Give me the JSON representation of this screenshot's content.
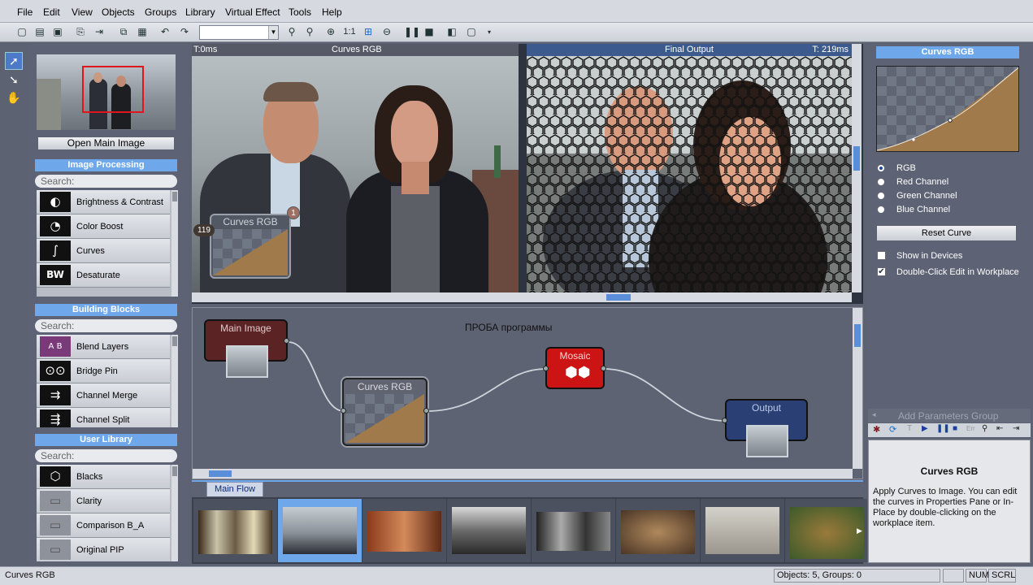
{
  "menu": [
    "File",
    "Edit",
    "View",
    "Objects",
    "Groups",
    "Library",
    "Virtual Effect",
    "Tools",
    "Help"
  ],
  "toolbar": {
    "zoom_value": "",
    "zoom_ratio": "1:1"
  },
  "left": {
    "open_button": "Open Main Image",
    "sections": [
      {
        "title": "Image Processing",
        "search_placeholder": "Search:",
        "items": [
          {
            "label": "Brightness & Contrast",
            "icon": "brightness-contrast-icon",
            "glyph": "◐"
          },
          {
            "label": "Color Boost",
            "icon": "color-boost-icon",
            "glyph": "◔"
          },
          {
            "label": "Curves",
            "icon": "curves-icon",
            "glyph": "∫"
          },
          {
            "label": "Desaturate",
            "icon": "desaturate-icon",
            "glyph": "BW"
          }
        ]
      },
      {
        "title": "Building Blocks",
        "search_placeholder": "Search:",
        "items": [
          {
            "label": "Blend Layers",
            "icon": "blend-layers-icon",
            "glyph": "A B"
          },
          {
            "label": "Bridge Pin",
            "icon": "bridge-pin-icon",
            "glyph": "⊙⊙"
          },
          {
            "label": "Channel Merge",
            "icon": "channel-merge-icon",
            "glyph": "⇉"
          },
          {
            "label": "Channel Split",
            "icon": "channel-split-icon",
            "glyph": "⇶"
          }
        ]
      },
      {
        "title": "User Library",
        "search_placeholder": "Search:",
        "items": [
          {
            "label": "Blacks",
            "icon": "blacks-icon",
            "glyph": "⬡"
          },
          {
            "label": "Clarity",
            "icon": "clarity-icon",
            "glyph": "▭"
          },
          {
            "label": "Comparison B_A",
            "icon": "comparison-icon",
            "glyph": "▭"
          },
          {
            "label": "Original PIP",
            "icon": "original-pip-icon",
            "glyph": "▭"
          }
        ]
      }
    ]
  },
  "viewer": {
    "left_time": "T:0ms",
    "left_title": "Curves RGB",
    "right_title": "Final Output",
    "right_time": "T: 219ms",
    "overlay_title": "Curves RGB",
    "overlay_badge": "1",
    "overlay_count": "119"
  },
  "flow": {
    "caption": "ПРОБА программы",
    "nodes": {
      "main": "Main Image",
      "curves": "Curves RGB",
      "mosaic": "Mosaic",
      "output": "Output"
    },
    "tab": "Main Flow"
  },
  "props": {
    "title": "Curves RGB",
    "channels": [
      "RGB",
      "Red Channel",
      "Green Channel",
      "Blue Channel"
    ],
    "selected_channel": "RGB",
    "reset_button": "Reset Curve",
    "show_in_devices": "Show in Devices",
    "double_click_edit": "Double-Click Edit in Workplace",
    "add_group": "Add Parameters Group",
    "help_title": "Curves RGB",
    "help_text": "Apply Curves to Image. You can edit the curves in Properties Pane or In-Place by double-clicking on the workplace item."
  },
  "status": {
    "left": "Curves RGB",
    "objects": "Objects: 5, Groups: 0",
    "num": "NUM",
    "scrl": "SCRL"
  },
  "colors": {
    "accent": "#6fa8ea",
    "mosaic_node": "#cc1414",
    "main_node": "#6a2a2a",
    "output_node": "#2a3f74"
  }
}
